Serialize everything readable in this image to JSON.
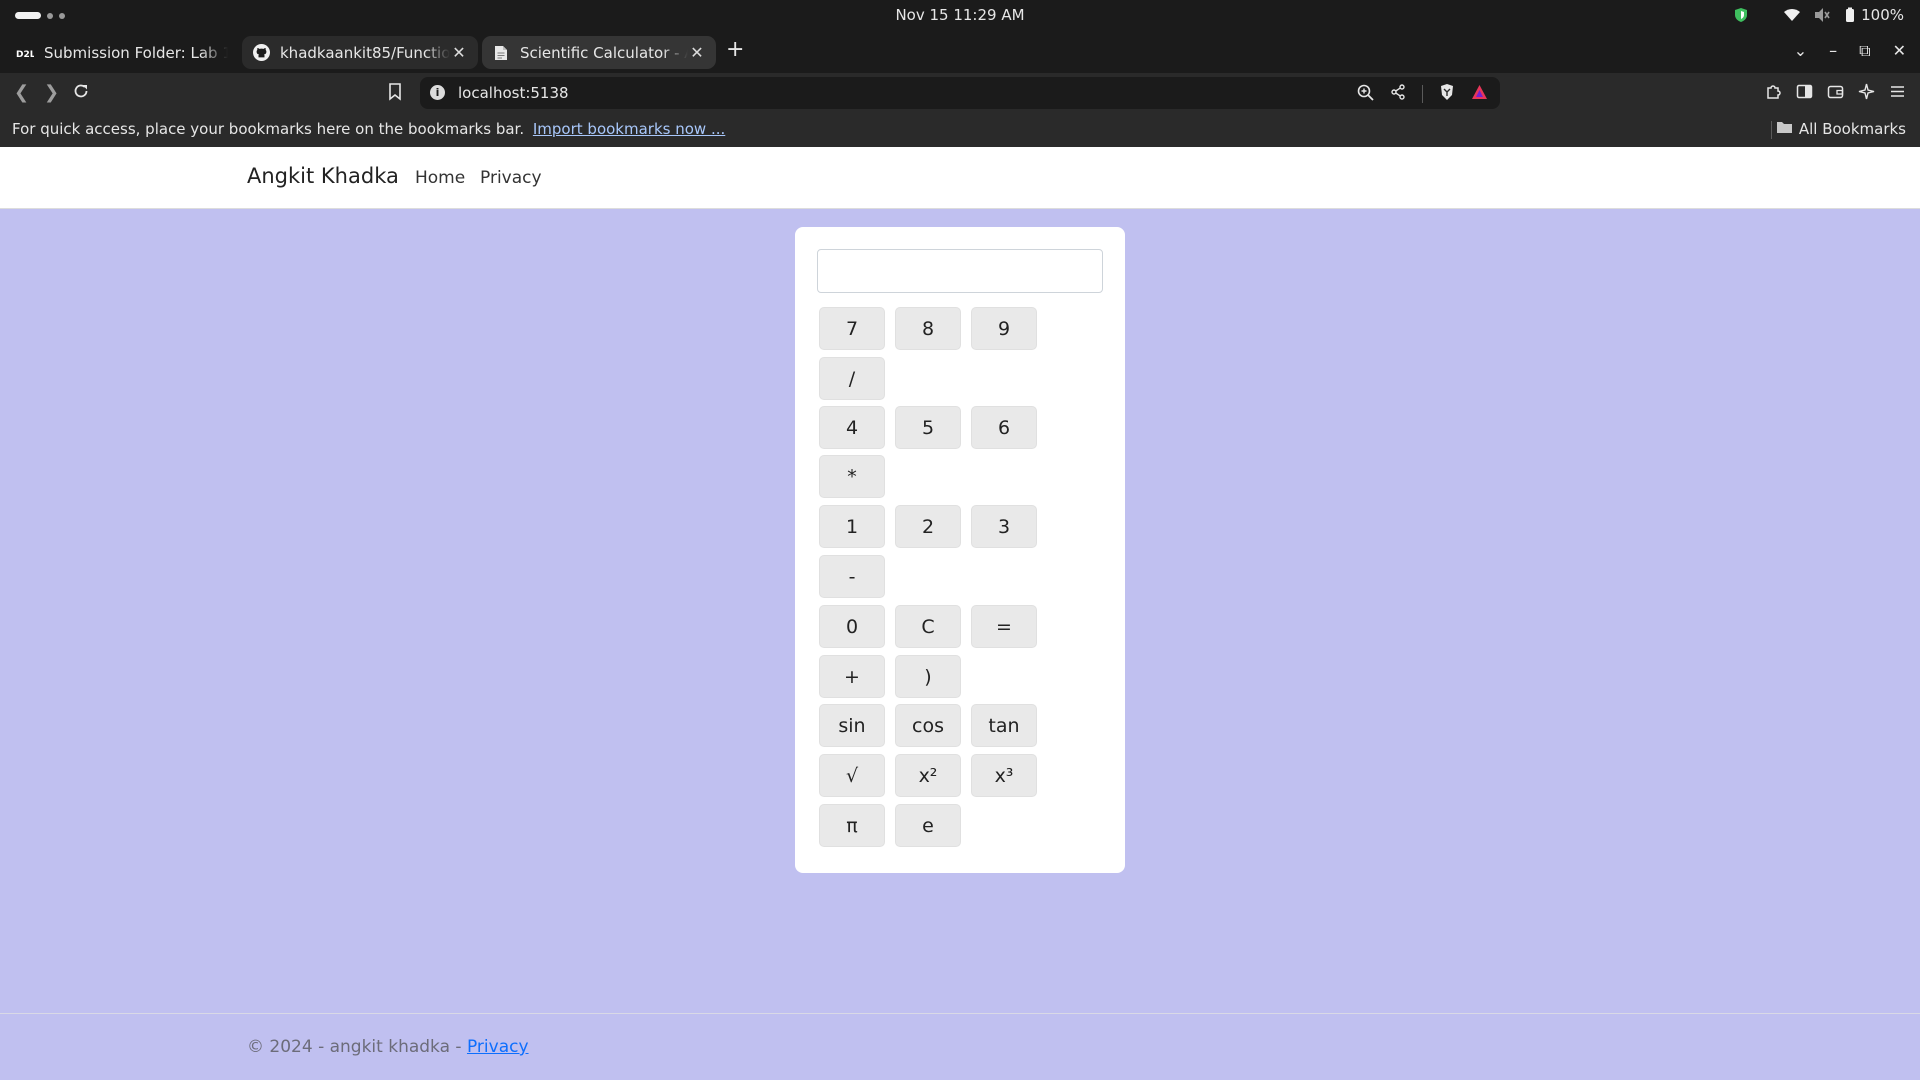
{
  "os": {
    "clock": "Nov 15  11:29 AM",
    "battery": "100%"
  },
  "tabs": [
    {
      "title": "Submission Folder: Lab 1 - Pr",
      "favicon": "d2l-icon"
    },
    {
      "title": "khadkaankit85/Functional",
      "favicon": "github-icon"
    },
    {
      "title": "Scientific Calculator - Angkit",
      "favicon": "document-icon"
    }
  ],
  "omnibox": {
    "url": "localhost:5138"
  },
  "bookmarks_bar": {
    "message": "For quick access, place your bookmarks here on the bookmarks bar.",
    "import_link": "Import bookmarks now ...",
    "all_bookmarks": "All Bookmarks"
  },
  "site": {
    "brand": "Angkit Khadka",
    "nav": {
      "home": "Home",
      "privacy": "Privacy"
    },
    "footer_text": "© 2024 - angkit khadka - ",
    "footer_link": "Privacy"
  },
  "calculator": {
    "display_value": "",
    "keys": {
      "k7": "7",
      "k8": "8",
      "k9": "9",
      "kdiv": "/",
      "k4": "4",
      "k5": "5",
      "k6": "6",
      "kmul": "*",
      "k1": "1",
      "k2": "2",
      "k3": "3",
      "ksub": "-",
      "k0": "0",
      "kclear": "C",
      "keq": "=",
      "kadd": "+",
      "krparen": ")",
      "ksin": "sin",
      "kcos": "cos",
      "ktan": "tan",
      "ksqrt": "√",
      "ksq": "x²",
      "kcube": "x³",
      "kpi": "π",
      "ke": "e"
    }
  },
  "colors": {
    "page_background": "#c0c0f0",
    "key_background": "#e9e9e9",
    "link": "#0d6efd"
  }
}
